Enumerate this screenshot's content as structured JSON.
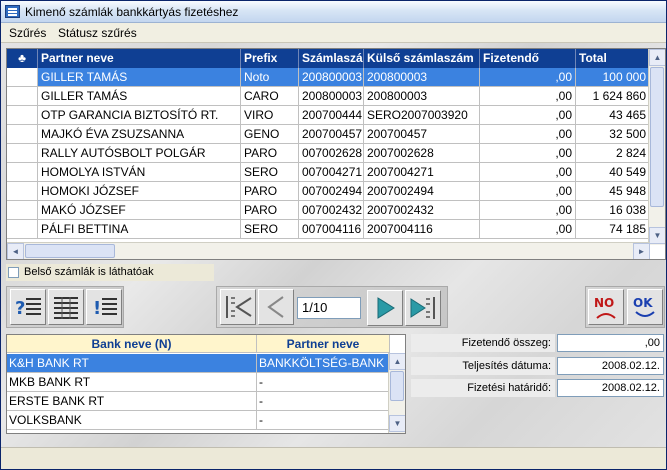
{
  "window": {
    "title": "Kimenő számlák bankkártyás fizetéshez"
  },
  "menu": {
    "items": [
      "Szűrés",
      "Státusz szűrés"
    ]
  },
  "invoices": {
    "indicator_header": "♣",
    "columns": [
      "Partner neve",
      "Prefix",
      "Számlaszá",
      "Külső számlaszám",
      "Fizetendő",
      "Total"
    ],
    "rows": [
      {
        "partner": "GILLER TAMÁS",
        "prefix": "Noto",
        "szamlaszam": "200800003",
        "kulso": "200800003",
        "fizetendo": ",00",
        "total": "100 000",
        "selected": true
      },
      {
        "partner": "GILLER TAMÁS",
        "prefix": "CARO",
        "szamlaszam": "200800003",
        "kulso": "200800003",
        "fizetendo": ",00",
        "total": "1 624 860"
      },
      {
        "partner": "OTP GARANCIA BIZTOSÍTÓ RT.",
        "prefix": "VIRO",
        "szamlaszam": "200700444",
        "kulso": "SERO2007003920",
        "fizetendo": ",00",
        "total": "43 465"
      },
      {
        "partner": "MAJKÓ ÉVA ZSUZSANNA",
        "prefix": "GENO",
        "szamlaszam": "200700457",
        "kulso": "200700457",
        "fizetendo": ",00",
        "total": "32 500"
      },
      {
        "partner": "RALLY AUTÓSBOLT POLGÁR",
        "prefix": "PARO",
        "szamlaszam": "007002628",
        "kulso": "2007002628",
        "fizetendo": ",00",
        "total": "2 824"
      },
      {
        "partner": "HOMOLYA ISTVÁN",
        "prefix": "SERO",
        "szamlaszam": "007004271",
        "kulso": "2007004271",
        "fizetendo": ",00",
        "total": "40 549"
      },
      {
        "partner": "HOMOKI JÓZSEF",
        "prefix": "PARO",
        "szamlaszam": "007002494",
        "kulso": "2007002494",
        "fizetendo": ",00",
        "total": "45 948"
      },
      {
        "partner": "MAKÓ JÓZSEF",
        "prefix": "PARO",
        "szamlaszam": "007002432",
        "kulso": "2007002432",
        "fizetendo": ",00",
        "total": "16 038"
      },
      {
        "partner": "PÁLFI BETTINA",
        "prefix": "SERO",
        "szamlaszam": "007004116",
        "kulso": "2007004116",
        "fizetendo": ",00",
        "total": "74 185"
      }
    ]
  },
  "checkbox": {
    "label": "Belső számlák is láthatóak",
    "checked": false
  },
  "pager": {
    "value": "1/10"
  },
  "buttons": {
    "no_label": "NO",
    "ok_label": "OK"
  },
  "banks": {
    "columns": [
      "Bank neve (N)",
      "Partner neve"
    ],
    "rows": [
      {
        "bank": "K&H BANK RT",
        "partner": "BANKKÖLTSÉG-BANK",
        "selected": true
      },
      {
        "bank": "MKB BANK RT",
        "partner": "-"
      },
      {
        "bank": "ERSTE BANK RT",
        "partner": "-"
      },
      {
        "bank": "VOLKSBANK",
        "partner": "-"
      }
    ]
  },
  "form": {
    "fizetendo_label": "Fizetendő összeg:",
    "fizetendo_value": ",00",
    "teljesites_label": "Teljesítés dátuma:",
    "teljesites_value": "2008.02.12.",
    "hatarido_label": "Fizetési határidő:",
    "hatarido_value": "2008.02.12."
  },
  "colors": {
    "header_blue": "#0f3f93",
    "selection_blue": "#3b82e0",
    "bank_header_bg": "#fff5cc"
  }
}
